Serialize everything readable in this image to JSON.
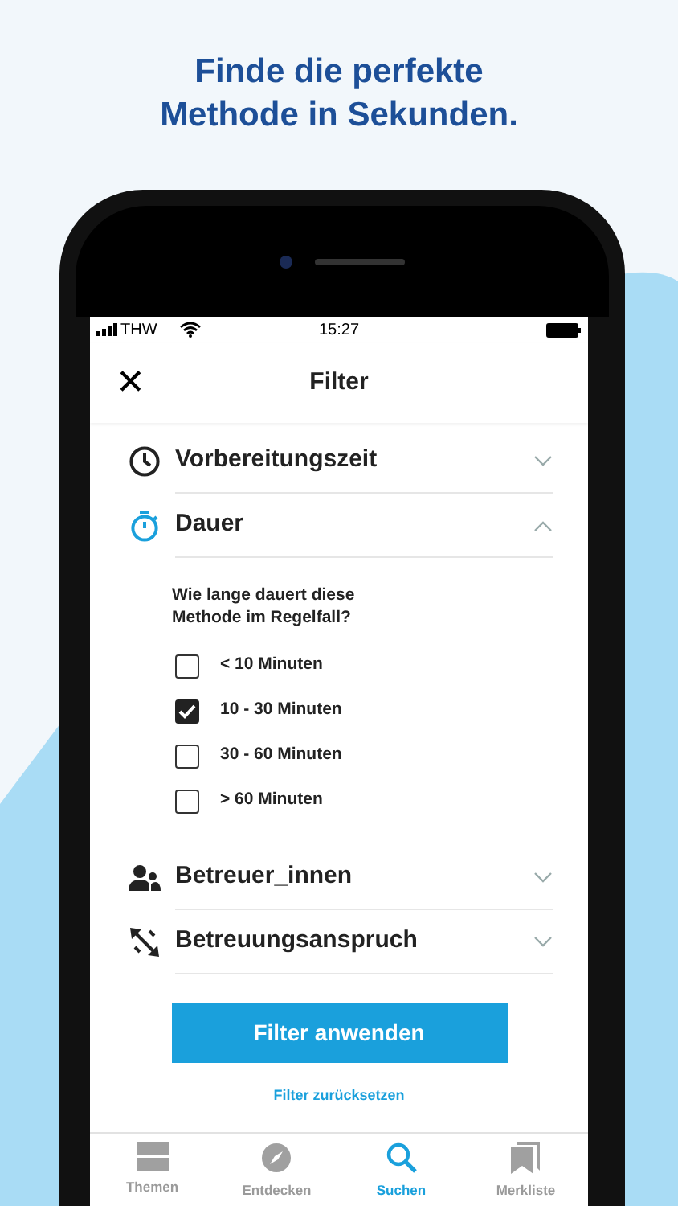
{
  "headline": "Finde die perfekte Methode in Sekunden.",
  "status_bar": {
    "carrier": "THW",
    "time": "15:27"
  },
  "header": {
    "close": "✕",
    "title": "Filter"
  },
  "sections": [
    {
      "kind": "clock",
      "label": "Vorbereitungszeit",
      "expanded": false
    },
    {
      "kind": "stopwatch",
      "label": "Dauer",
      "expanded": true,
      "question": "Wie lange dauert diese Methode im Regelfall?",
      "options": [
        {
          "label": "< 10 Minuten",
          "checked": false
        },
        {
          "label": "10 - 30 Minuten",
          "checked": true
        },
        {
          "label": "30 - 60 Minuten",
          "checked": false
        },
        {
          "label": "> 60 Minuten",
          "checked": false
        }
      ]
    },
    {
      "kind": "people",
      "label": "Betreuer_innen",
      "expanded": false
    },
    {
      "kind": "arrows",
      "label": "Betreuungsanspruch",
      "expanded": false
    }
  ],
  "apply_button": "Filter anwenden",
  "reset_link": "Filter zurücksetzen",
  "tabs": [
    {
      "kind": "topics",
      "label": "Themen",
      "selected": false
    },
    {
      "kind": "compass",
      "label": "Entdecken",
      "selected": false
    },
    {
      "kind": "search",
      "label": "Suchen",
      "selected": true
    },
    {
      "kind": "bookmark",
      "label": "Merkliste",
      "selected": false
    }
  ]
}
